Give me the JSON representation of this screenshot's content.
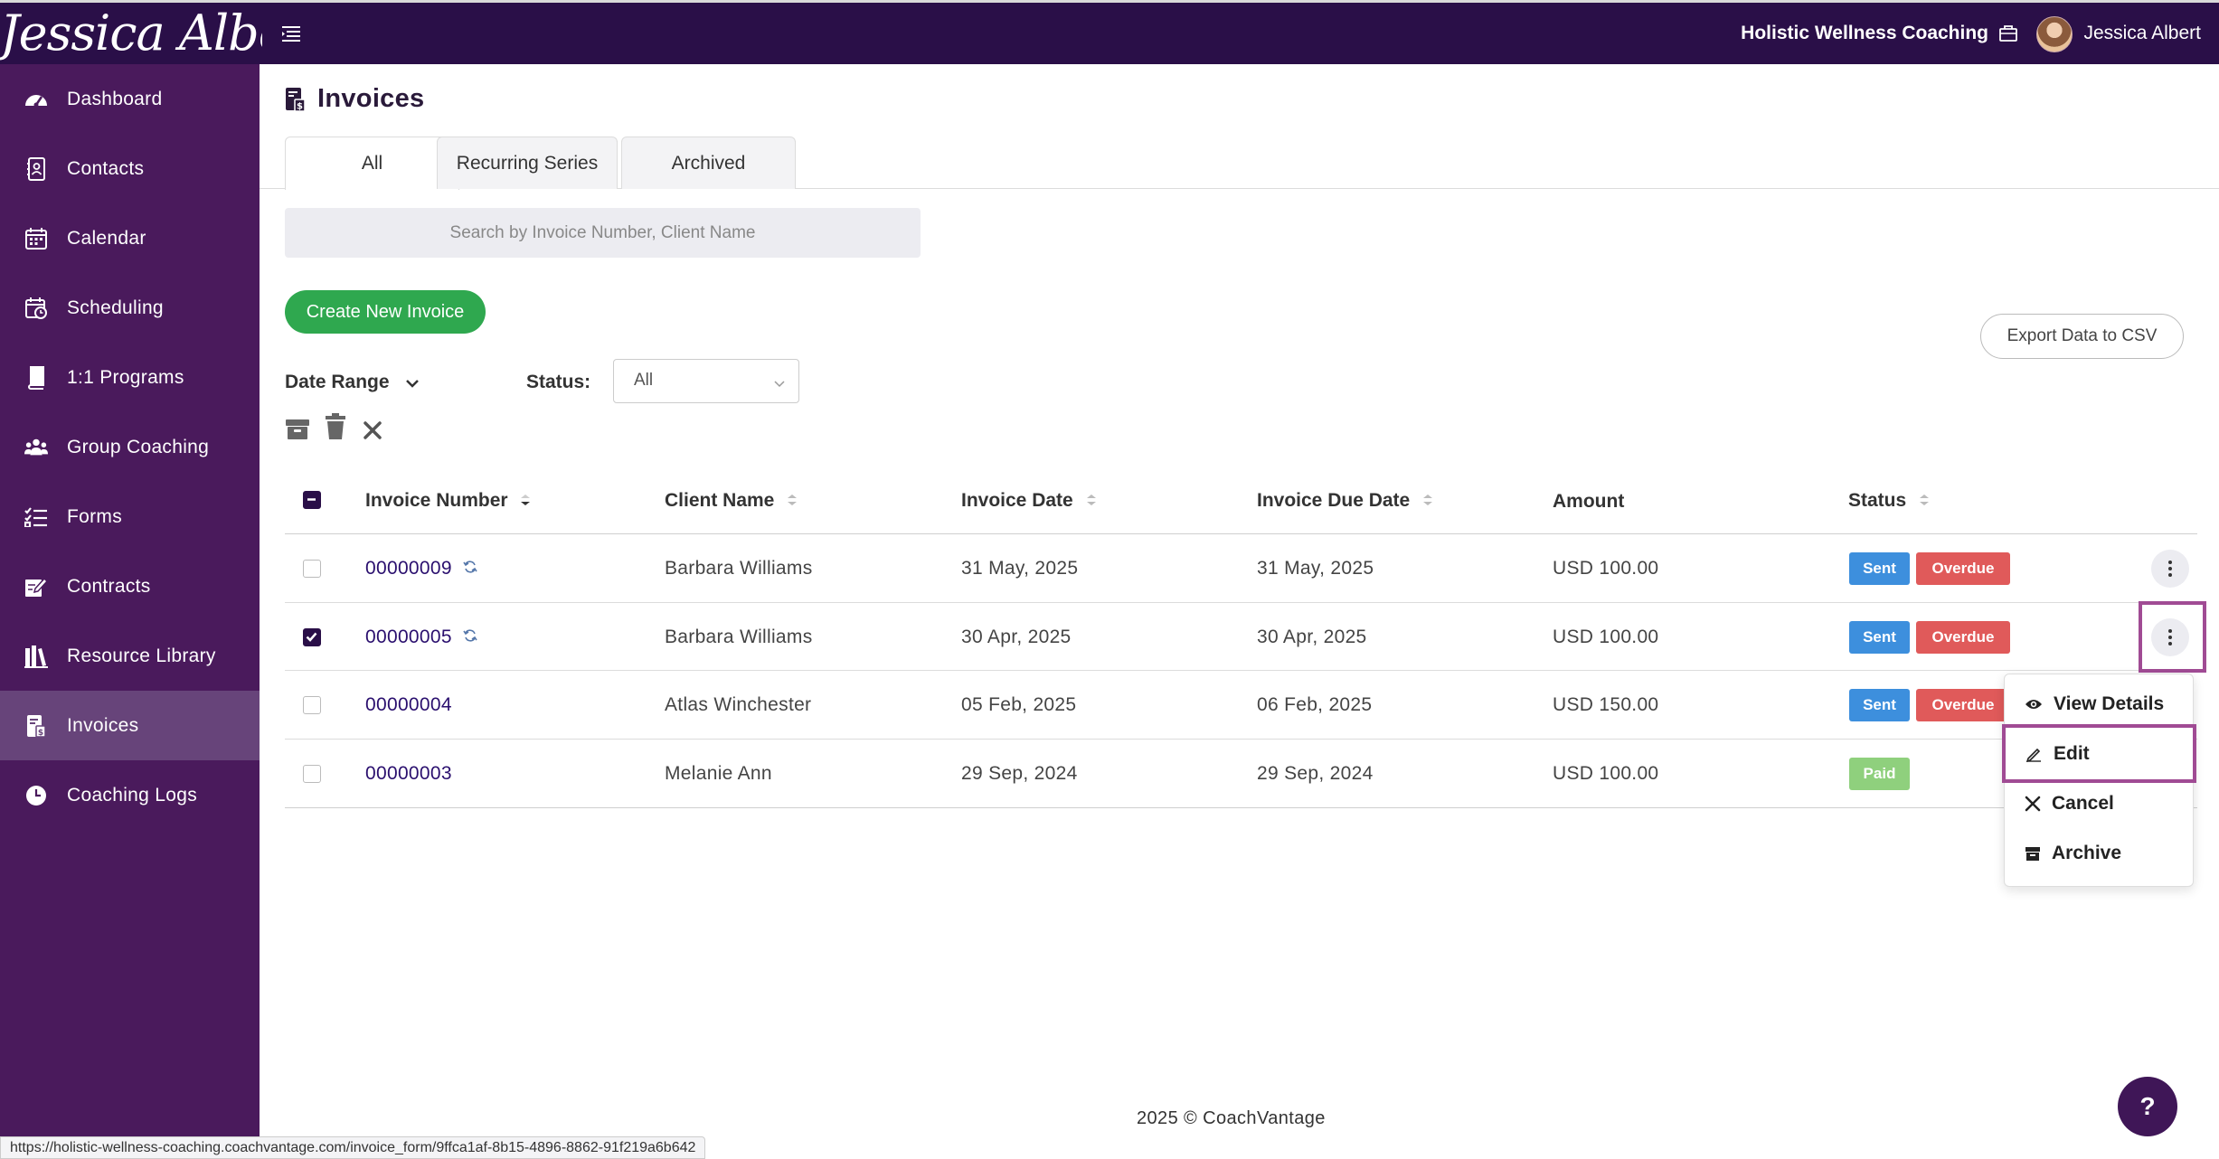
{
  "header": {
    "logo_text": "Jessica Albert",
    "business_name": "Holistic Wellness Coaching",
    "user_name": "Jessica Albert"
  },
  "sidebar": {
    "items": [
      {
        "label": "Dashboard",
        "icon": "dashboard-icon"
      },
      {
        "label": "Contacts",
        "icon": "contacts-icon"
      },
      {
        "label": "Calendar",
        "icon": "calendar-icon"
      },
      {
        "label": "Scheduling",
        "icon": "scheduling-icon"
      },
      {
        "label": "1:1 Programs",
        "icon": "book-icon"
      },
      {
        "label": "Group Coaching",
        "icon": "group-icon"
      },
      {
        "label": "Forms",
        "icon": "forms-icon"
      },
      {
        "label": "Contracts",
        "icon": "contract-icon"
      },
      {
        "label": "Resource Library",
        "icon": "library-icon"
      },
      {
        "label": "Invoices",
        "icon": "invoice-icon",
        "active": true
      },
      {
        "label": "Coaching Logs",
        "icon": "clock-icon"
      }
    ]
  },
  "page": {
    "title": "Invoices",
    "tabs": [
      {
        "label": "All",
        "active": true
      },
      {
        "label": "Recurring Series"
      },
      {
        "label": "Archived"
      }
    ],
    "search_placeholder": "Search by Invoice Number, Client Name",
    "create_button": "Create New Invoice",
    "export_button": "Export Data to CSV",
    "date_range_label": "Date Range",
    "status_label": "Status:",
    "status_value": "All"
  },
  "table": {
    "headers": {
      "invoice_number": "Invoice Number",
      "client_name": "Client Name",
      "invoice_date": "Invoice Date",
      "due_date": "Invoice Due Date",
      "amount": "Amount",
      "status": "Status"
    },
    "rows": [
      {
        "number": "00000009",
        "recurring": true,
        "client": "Barbara Williams",
        "date": "31 May, 2025",
        "due": "31 May, 2025",
        "amount": "USD 100.00",
        "badges": [
          "Sent",
          "Overdue"
        ],
        "checked": false
      },
      {
        "number": "00000005",
        "recurring": true,
        "client": "Barbara Williams",
        "date": "30 Apr, 2025",
        "due": "30 Apr, 2025",
        "amount": "USD 100.00",
        "badges": [
          "Sent",
          "Overdue"
        ],
        "checked": true
      },
      {
        "number": "00000004",
        "recurring": false,
        "client": "Atlas Winchester",
        "date": "05 Feb, 2025",
        "due": "06 Feb, 2025",
        "amount": "USD 150.00",
        "badges": [
          "Sent",
          "Overdue"
        ],
        "checked": false
      },
      {
        "number": "00000003",
        "recurring": false,
        "client": "Melanie Ann",
        "date": "29 Sep, 2024",
        "due": "29 Sep, 2024",
        "amount": "USD 100.00",
        "badges": [
          "Paid"
        ],
        "checked": false
      }
    ]
  },
  "row_menu": {
    "view_details": "View Details",
    "edit": "Edit",
    "cancel": "Cancel",
    "archive": "Archive"
  },
  "footer": {
    "copyright": "2025 © CoachVantage",
    "help": "?"
  },
  "status_bar": {
    "url": "https://holistic-wellness-coaching.coachvantage.com/invoice_form/9ffca1af-8b15-4896-8862-91f219a6b642"
  },
  "colors": {
    "topbar": "#2a0f48",
    "sidebar": "#4a1a5c",
    "sidebar_active": "#67447a",
    "create_button": "#2fa84f",
    "sent": "#3d8fdd",
    "overdue": "#e05a5a",
    "paid": "#8fd07d",
    "highlight": "#a04b94"
  }
}
